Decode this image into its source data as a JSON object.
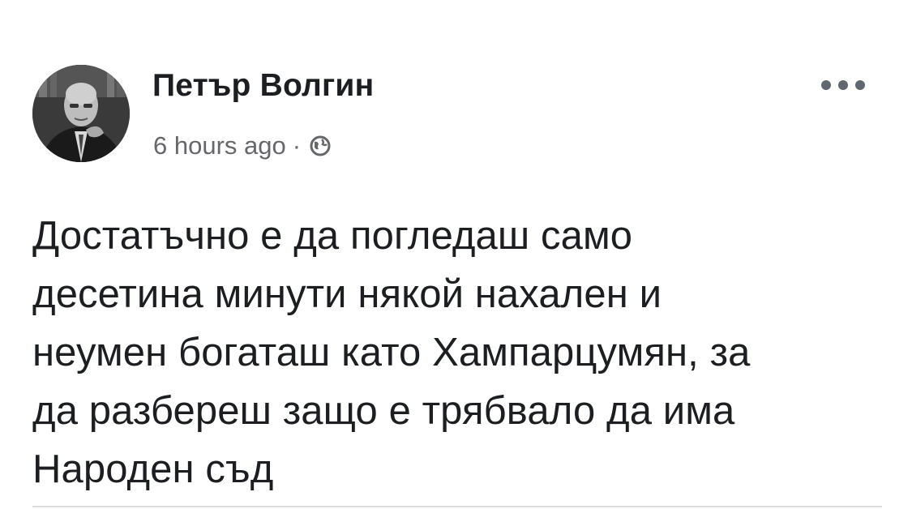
{
  "post": {
    "author": {
      "name": "Петър Волгин",
      "avatar_icon": "profile-photo"
    },
    "meta": {
      "time": "6 hours ago",
      "separator": "·",
      "privacy_icon": "globe-icon"
    },
    "more_icon": "more-options-icon",
    "text": "Достатъчно е да погледаш само\nдесетина минути някой нахален и\nнеумен богаташ като Хампарцумян, за\nда разбереш защо е трябвало да има\nНароден съд"
  },
  "colors": {
    "text": "#1c1e21",
    "secondary_text": "#65676b",
    "divider": "#dcdcdc"
  }
}
